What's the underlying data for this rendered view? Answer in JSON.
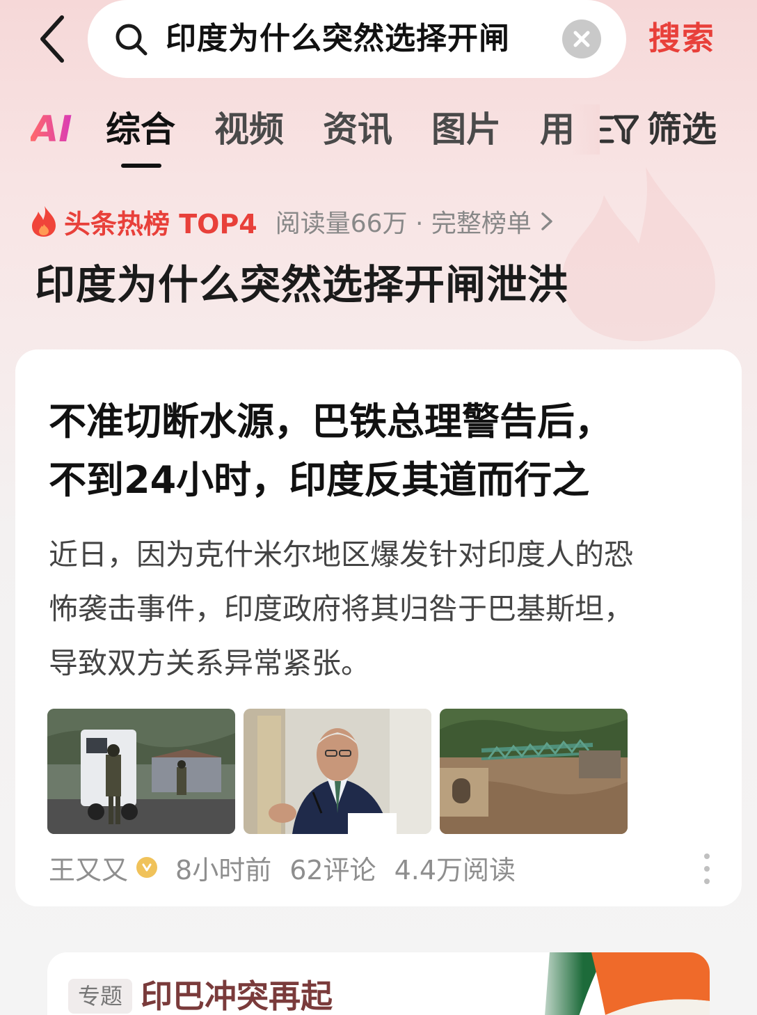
{
  "search": {
    "query": "印度为什么突然选择开闸",
    "submit_label": "搜索"
  },
  "tabs": {
    "ai_label": "AI",
    "items": [
      {
        "label": "综合",
        "active": true
      },
      {
        "label": "视频",
        "active": false
      },
      {
        "label": "资讯",
        "active": false
      },
      {
        "label": "图片",
        "active": false
      },
      {
        "label": "用",
        "active": false
      }
    ],
    "filter_label": "筛选"
  },
  "hot": {
    "label": "头条热榜 TOP4",
    "meta": "阅读量66万 · 完整榜单",
    "topic_title": "印度为什么突然选择开闸泄洪"
  },
  "article": {
    "headline_lines": [
      "不准切断水源，巴铁总理警告后，",
      "不到24小时，印度反其道而行之"
    ],
    "summary_lines": [
      "近日，因为克什米尔地区爆发针对印度人的恐",
      "怖袭击事件，印度政府将其归咎于巴基斯坦，",
      "导致双方关系异常紧张。"
    ],
    "author": "王又又",
    "time": "8小时前",
    "comments": "62评论",
    "reads": "4.4万阅读"
  },
  "topic_card": {
    "tag": "专题",
    "title": "印巴冲突再起"
  },
  "colors": {
    "accent_red": "#e8403a",
    "ai_gradient_start": "#ff6a6a",
    "ai_gradient_end": "#d93ab6",
    "verified_badge": "#f0c25a"
  },
  "icons": [
    "back-arrow-icon",
    "search-icon",
    "clear-icon",
    "filter-icon",
    "flame-icon",
    "chevron-right-icon",
    "verified-icon",
    "more-vertical-icon"
  ]
}
